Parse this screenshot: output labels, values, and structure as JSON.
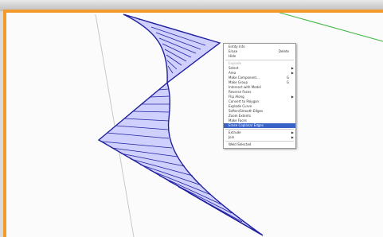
{
  "scene": {
    "colors": {
      "frame": "#f29a2e",
      "shape_stroke": "#2020a0",
      "shape_fill": "#c8c8ff",
      "axis_green": "#3cb43c",
      "axis_gray": "#c8c8c8"
    }
  },
  "context_menu": {
    "selected_index": 17,
    "items": [
      {
        "type": "item",
        "label": "Entity Info",
        "shortcut": "",
        "submenu": false,
        "disabled": false
      },
      {
        "type": "item",
        "label": "Erase",
        "shortcut": "Delete",
        "submenu": false,
        "disabled": false
      },
      {
        "type": "item",
        "label": "Hide",
        "shortcut": "",
        "submenu": false,
        "disabled": false
      },
      {
        "type": "separator"
      },
      {
        "type": "item",
        "label": "Explode",
        "shortcut": "",
        "submenu": false,
        "disabled": true
      },
      {
        "type": "item",
        "label": "Select",
        "shortcut": "",
        "submenu": true,
        "disabled": false
      },
      {
        "type": "item",
        "label": "Area",
        "shortcut": "",
        "submenu": true,
        "disabled": false
      },
      {
        "type": "item",
        "label": "Make Component...",
        "shortcut": "G",
        "submenu": false,
        "disabled": false
      },
      {
        "type": "item",
        "label": "Make Group",
        "shortcut": "G",
        "submenu": false,
        "disabled": false
      },
      {
        "type": "item",
        "label": "Intersect with Model",
        "shortcut": "",
        "submenu": false,
        "disabled": false
      },
      {
        "type": "item",
        "label": "Reverse Faces",
        "shortcut": "",
        "submenu": false,
        "disabled": false
      },
      {
        "type": "item",
        "label": "Flip Along",
        "shortcut": "",
        "submenu": true,
        "disabled": false
      },
      {
        "type": "item",
        "label": "Convert to Polygon",
        "shortcut": "",
        "submenu": false,
        "disabled": false
      },
      {
        "type": "item",
        "label": "Explode Curve",
        "shortcut": "",
        "submenu": false,
        "disabled": false
      },
      {
        "type": "item",
        "label": "Soften/Smooth Edges",
        "shortcut": "",
        "submenu": false,
        "disabled": false
      },
      {
        "type": "item",
        "label": "Zoom Extents",
        "shortcut": "",
        "submenu": false,
        "disabled": false
      },
      {
        "type": "item",
        "label": "Make Faces",
        "shortcut": "",
        "submenu": false,
        "disabled": false
      },
      {
        "type": "item",
        "label": "Erase Coplanar Edges",
        "shortcut": "",
        "submenu": false,
        "disabled": false
      },
      {
        "type": "separator"
      },
      {
        "type": "item",
        "label": "Extrude",
        "shortcut": "",
        "submenu": true,
        "disabled": false
      },
      {
        "type": "item",
        "label": "Join",
        "shortcut": "",
        "submenu": true,
        "disabled": false
      },
      {
        "type": "separator"
      },
      {
        "type": "item",
        "label": "Weld Selected",
        "shortcut": "",
        "submenu": false,
        "disabled": false
      }
    ]
  }
}
